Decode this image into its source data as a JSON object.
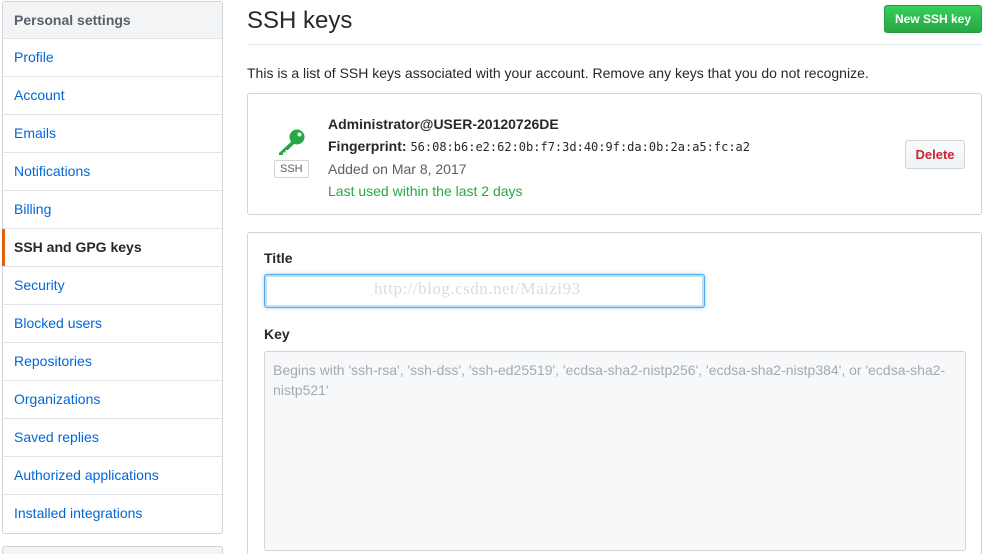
{
  "sidebar": {
    "header": "Personal settings",
    "items": [
      {
        "label": "Profile"
      },
      {
        "label": "Account"
      },
      {
        "label": "Emails"
      },
      {
        "label": "Notifications"
      },
      {
        "label": "Billing"
      },
      {
        "label": "SSH and GPG keys",
        "selected": true
      },
      {
        "label": "Security"
      },
      {
        "label": "Blocked users"
      },
      {
        "label": "Repositories"
      },
      {
        "label": "Organizations"
      },
      {
        "label": "Saved replies"
      },
      {
        "label": "Authorized applications"
      },
      {
        "label": "Installed integrations"
      }
    ]
  },
  "header": {
    "title": "SSH keys",
    "new_key_button": "New SSH key"
  },
  "intro": "This is a list of SSH keys associated with your account. Remove any keys that you do not recognize.",
  "key": {
    "icon": "key-icon",
    "type_label": "SSH",
    "title": "Administrator@USER-20120726DE",
    "fingerprint_label": "Fingerprint:",
    "fingerprint": "56:08:b6:e2:62:0b:f7:3d:40:9f:da:0b:2a:a5:fc:a2",
    "added": "Added on Mar 8, 2017",
    "last_used": "Last used within the last 2 days",
    "delete_button": "Delete"
  },
  "form": {
    "title_label": "Title",
    "title_value": "",
    "watermark": "http://blog.csdn.net/Maizi93",
    "key_label": "Key",
    "key_placeholder": "Begins with 'ssh-rsa', 'ssh-dss', 'ssh-ed25519', 'ecdsa-sha2-nistp256', 'ecdsa-sha2-nistp384', or 'ecdsa-sha2-nistp521'"
  },
  "colors": {
    "link": "#0366d6",
    "accent_selected": "#e36209",
    "primary_button": "#28a745",
    "danger": "#cb2431",
    "key_icon": "#28a745"
  }
}
